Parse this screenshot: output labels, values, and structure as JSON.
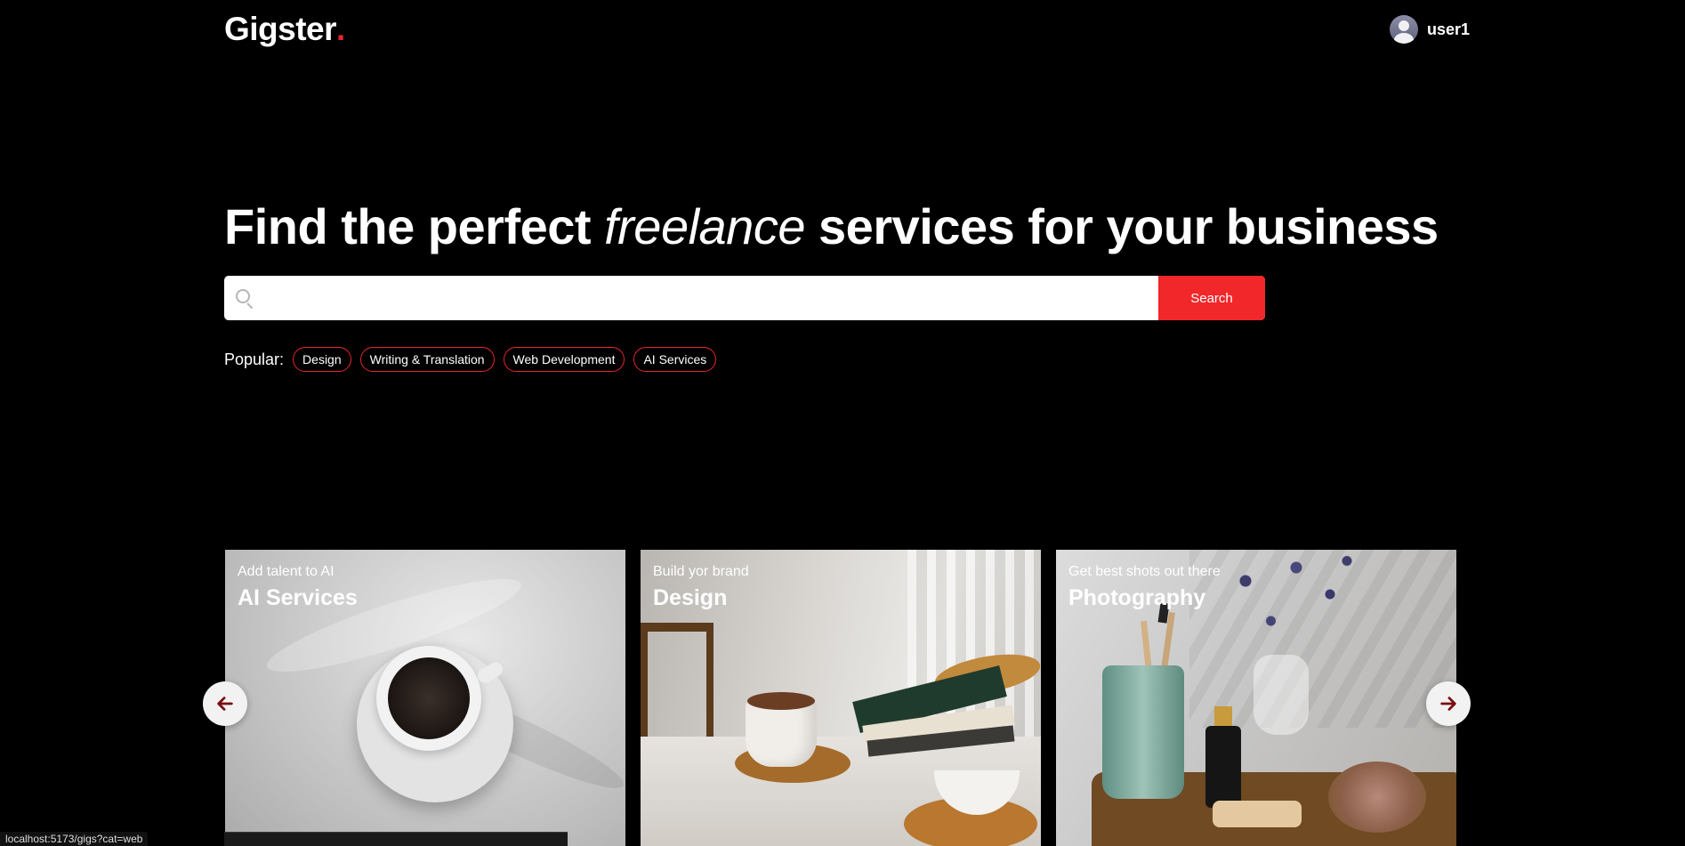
{
  "header": {
    "logo_text": "Gigster",
    "logo_dot": ".",
    "username": "user1"
  },
  "hero": {
    "title_before": "Find the perfect ",
    "title_emphasis": "freelance",
    "title_after": " services for your business"
  },
  "search": {
    "placeholder": "",
    "value": "",
    "button_label": "Search"
  },
  "popular": {
    "label": "Popular:",
    "tags": [
      "Design",
      "Writing & Translation",
      "Web Development",
      "AI Services"
    ]
  },
  "carousel": {
    "cards": [
      {
        "subtitle": "Add talent to AI",
        "title": "AI Services"
      },
      {
        "subtitle": "Build yor brand",
        "title": "Design"
      },
      {
        "subtitle": "Get best shots out there",
        "title": "Photography"
      }
    ]
  },
  "status_bar": {
    "url": "localhost:5173/gigs?cat=web"
  },
  "colors": {
    "accent": "#f1272a",
    "background": "#000000"
  },
  "icons": {
    "search": "search-icon",
    "prev": "arrow-left-icon",
    "next": "arrow-right-icon"
  }
}
